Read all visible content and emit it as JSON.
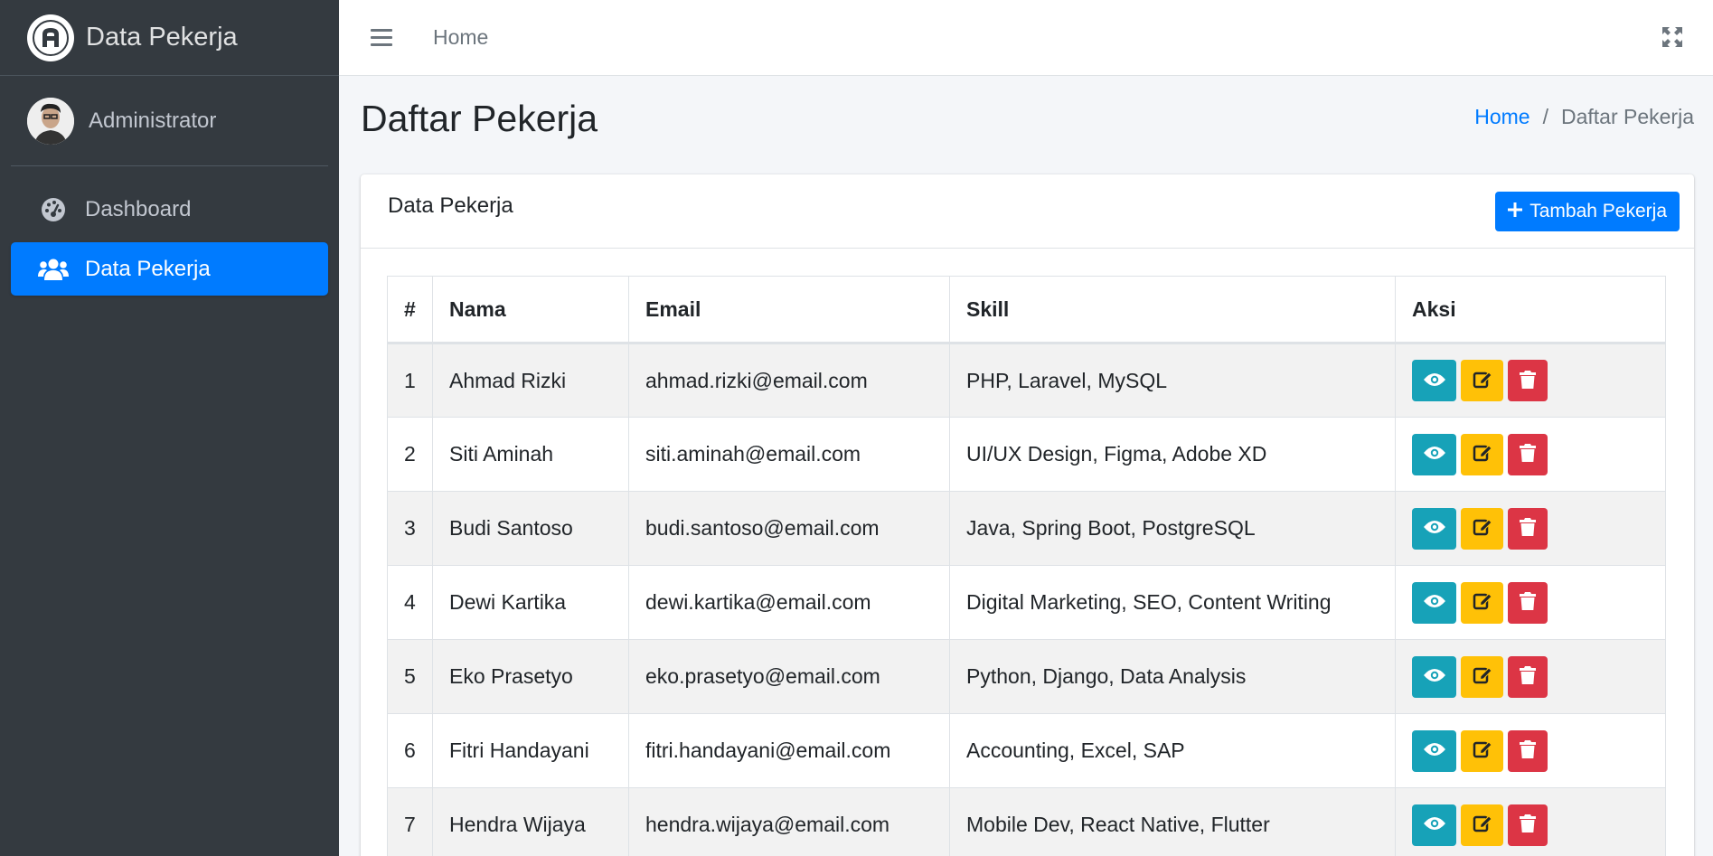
{
  "brand": {
    "title": "Data Pekerja",
    "logo_icon": "brand-a-logo-icon"
  },
  "user": {
    "name": "Administrator"
  },
  "sidebar": {
    "items": [
      {
        "label": "Dashboard",
        "icon": "tachometer-icon",
        "active": false
      },
      {
        "label": "Data Pekerja",
        "icon": "users-icon",
        "active": true
      }
    ]
  },
  "topbar": {
    "home_label": "Home"
  },
  "page": {
    "title": "Daftar Pekerja"
  },
  "breadcrumb": {
    "home": "Home",
    "separator": "/",
    "current": "Daftar Pekerja"
  },
  "card": {
    "title": "Data Pekerja",
    "add_label": "Tambah Pekerja"
  },
  "table": {
    "headers": [
      "#",
      "Nama",
      "Email",
      "Skill",
      "Aksi"
    ],
    "rows": [
      {
        "no": "1",
        "nama": "Ahmad Rizki",
        "email": "ahmad.rizki@email.com",
        "skill": "PHP, Laravel, MySQL"
      },
      {
        "no": "2",
        "nama": "Siti Aminah",
        "email": "siti.aminah@email.com",
        "skill": "UI/UX Design, Figma, Adobe XD"
      },
      {
        "no": "3",
        "nama": "Budi Santoso",
        "email": "budi.santoso@email.com",
        "skill": "Java, Spring Boot, PostgreSQL"
      },
      {
        "no": "4",
        "nama": "Dewi Kartika",
        "email": "dewi.kartika@email.com",
        "skill": "Digital Marketing, SEO, Content Writing"
      },
      {
        "no": "5",
        "nama": "Eko Prasetyo",
        "email": "eko.prasetyo@email.com",
        "skill": "Python, Django, Data Analysis"
      },
      {
        "no": "6",
        "nama": "Fitri Handayani",
        "email": "fitri.handayani@email.com",
        "skill": "Accounting, Excel, SAP"
      },
      {
        "no": "7",
        "nama": "Hendra Wijaya",
        "email": "hendra.wijaya@email.com",
        "skill": "Mobile Dev, React Native, Flutter"
      }
    ]
  },
  "colors": {
    "sidebar_bg": "#343a40",
    "primary": "#007bff",
    "info": "#17a2b8",
    "warning": "#ffc107",
    "danger": "#dc3545"
  }
}
